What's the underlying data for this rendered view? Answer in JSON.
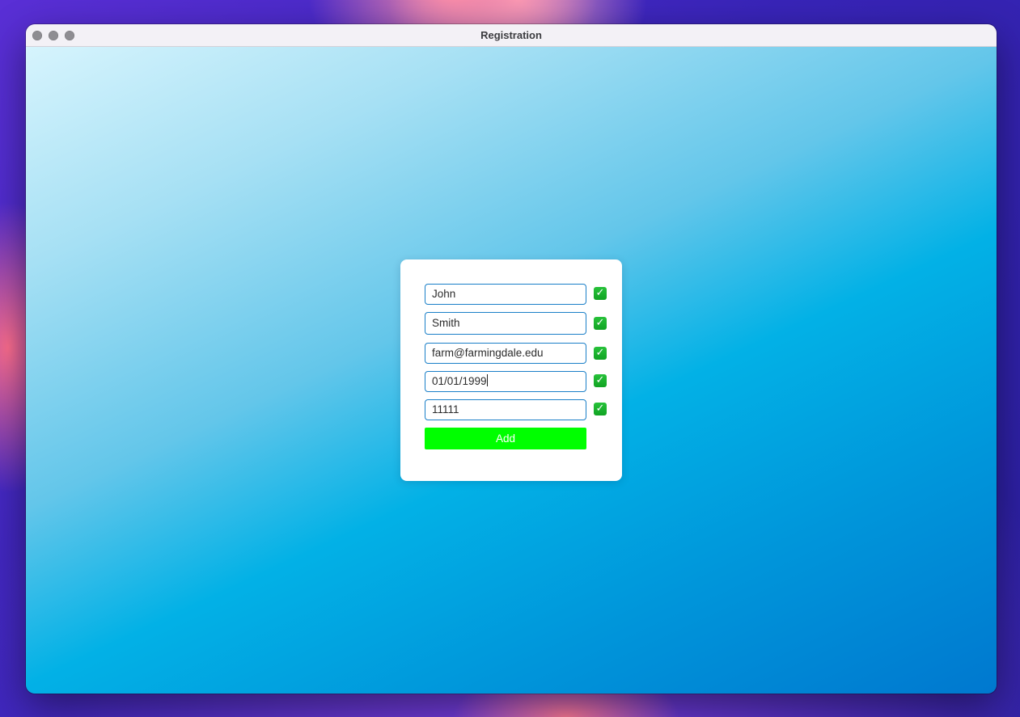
{
  "window": {
    "title": "Registration"
  },
  "form": {
    "fields": [
      {
        "name": "first-name",
        "value": "John",
        "valid_icon": "check-icon"
      },
      {
        "name": "last-name",
        "value": "Smith",
        "valid_icon": "check-icon"
      },
      {
        "name": "email",
        "value": "farm@farmingdale.edu",
        "valid_icon": "check-icon"
      },
      {
        "name": "date-of-birth",
        "value": "01/01/1999",
        "valid_icon": "check-icon",
        "focused": true
      },
      {
        "name": "zip-code",
        "value": "11111",
        "valid_icon": "check-icon"
      }
    ],
    "check_glyph": "✓",
    "add_label": "Add"
  },
  "colors": {
    "field_border": "#1a7fc8",
    "check_green": "#11a323",
    "add_button": "#00ff00"
  }
}
